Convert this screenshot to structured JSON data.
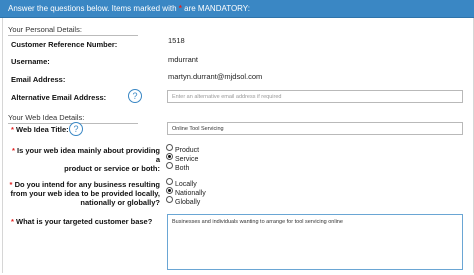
{
  "banner": {
    "text_before": "Answer the questions below. Items marked with",
    "asterisk": "*",
    "text_after": "are MANDATORY:"
  },
  "personal": {
    "section_title": "Your Personal Details:",
    "customer_ref_label": "Customer Reference Number:",
    "customer_ref_value": "1518",
    "username_label": "Username:",
    "username_value": "mdurrant",
    "email_label": "Email Address:",
    "email_value": "martyn.durrant@mjdsol.com",
    "alt_email_label": "Alternative Email Address:",
    "alt_email_placeholder": "Enter an alternative email address if required"
  },
  "web": {
    "section_title": "Your Web Idea Details:",
    "required_mark": "*",
    "title_label": "Web Idea Title:",
    "title_value": "Online Tool Servicing",
    "product_service_label_1": "Is your web idea mainly about providing a",
    "product_service_label_2": "product or service or both:",
    "product_service_options": [
      {
        "label": "Product",
        "checked": false
      },
      {
        "label": "Service",
        "checked": true
      },
      {
        "label": "Both",
        "checked": false
      }
    ],
    "scope_label_1": "Do you intend for any business resulting",
    "scope_label_2": "from your web idea to be provided locally,",
    "scope_label_3": "nationally or globally?",
    "scope_options": [
      {
        "label": "Locally",
        "checked": false
      },
      {
        "label": "Nationally",
        "checked": true
      },
      {
        "label": "Globally",
        "checked": false
      }
    ],
    "customer_base_label": "What is your targeted customer base?",
    "customer_base_value": "Businesses and individuals wanting to arrange for tool servicing online"
  },
  "icons": {
    "help_icon": "?"
  },
  "colors": {
    "banner_bg": "#3a87c4",
    "required": "#e32020",
    "accent": "#3a87c4"
  }
}
